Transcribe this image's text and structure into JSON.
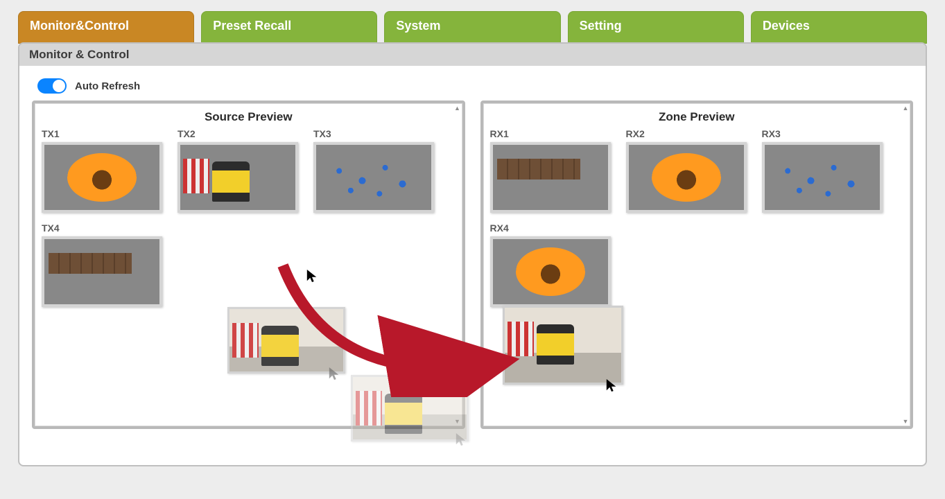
{
  "tabs": [
    {
      "id": "monitor",
      "label": "Monitor&Control",
      "active": true
    },
    {
      "id": "preset",
      "label": "Preset Recall",
      "active": false
    },
    {
      "id": "system",
      "label": "System",
      "active": false
    },
    {
      "id": "setting",
      "label": "Setting",
      "active": false
    },
    {
      "id": "devices",
      "label": "Devices",
      "active": false
    }
  ],
  "panel": {
    "title": "Monitor & Control"
  },
  "autoRefresh": {
    "label": "Auto Refresh",
    "on": true
  },
  "source": {
    "title": "Source Preview",
    "items": [
      {
        "label": "TX1",
        "kind": "flower"
      },
      {
        "label": "TX2",
        "kind": "train"
      },
      {
        "label": "TX3",
        "kind": "sports"
      },
      {
        "label": "TX4",
        "kind": "canal"
      }
    ]
  },
  "zone": {
    "title": "Zone Preview",
    "items": [
      {
        "label": "RX1",
        "kind": "canal"
      },
      {
        "label": "RX2",
        "kind": "flower"
      },
      {
        "label": "RX3",
        "kind": "sports"
      },
      {
        "label": "RX4",
        "kind": "flower"
      }
    ]
  },
  "drag": {
    "sourceIndex": 1,
    "targetZone": "RX4"
  }
}
